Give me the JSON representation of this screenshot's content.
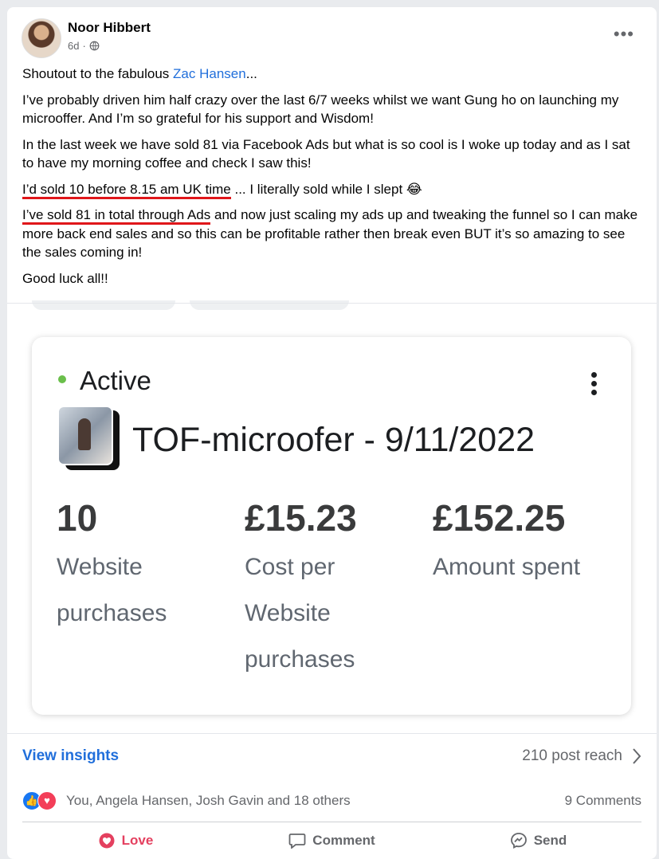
{
  "post": {
    "author": "Noor Hibbert",
    "time": "6d",
    "mention_prefix": "Shoutout to the fabulous ",
    "mention_name": "Zac Hansen",
    "mention_suffix": "...",
    "para2": "I’ve probably driven him half crazy over the last 6/7 weeks whilst we want Gung ho on launching my microoffer. And I’m so grateful for his support and Wisdom!",
    "para3": "In the last week we have sold 81 via Facebook Ads but what is so cool is I woke up today and as I sat to have my morning coffee and check I saw this!",
    "para4_underlined": "I’d sold 10 before 8.15 am UK time",
    "para4_rest": " ... I literally sold while I slept 😂",
    "para5_underlined": "I’ve sold 81 in total through Ads",
    "para5_rest": " and now just scaling my ads up and tweaking the funnel so I can make more back end sales and so this can be profitable rather then break even BUT it’s so amazing to see the sales coming in!",
    "para6": "Good luck all!!"
  },
  "ad": {
    "status": "Active",
    "name": "TOF-microofer - 9/11/2022",
    "metrics": [
      {
        "value": "10",
        "label": "Website purchases"
      },
      {
        "value": "£15.23",
        "label": "Cost per Website purchases"
      },
      {
        "value": "£152.25",
        "label": "Amount spent"
      }
    ]
  },
  "footer": {
    "view_insights": "View insights",
    "reach": "210 post reach",
    "reactions_text": "You, Angela Hansen, Josh Gavin and 18 others",
    "comments": "9 Comments",
    "actions": {
      "love": "Love",
      "comment": "Comment",
      "send": "Send"
    }
  },
  "icons": [
    "globe-icon",
    "more-icon",
    "kebab-icon",
    "chevron-right-icon",
    "like-reaction-icon",
    "love-reaction-icon",
    "heart-icon",
    "comment-icon",
    "messenger-icon"
  ],
  "colors": {
    "link": "#216fdb",
    "underline": "#e0161a",
    "active": "#6abf4b",
    "love": "#e4405f"
  }
}
